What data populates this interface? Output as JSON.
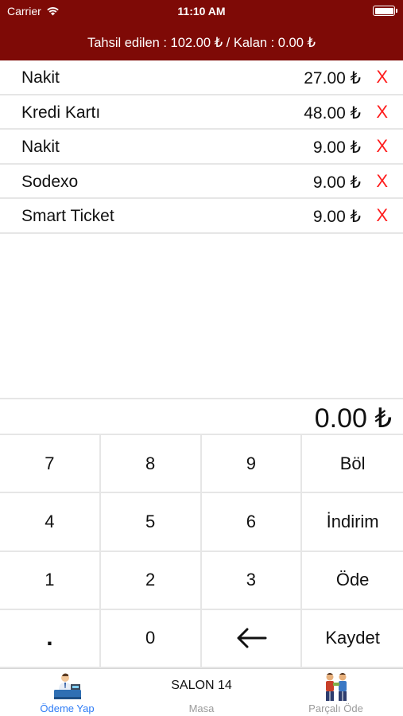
{
  "status_bar": {
    "carrier": "Carrier",
    "time": "11:10 AM"
  },
  "header": {
    "summary": "Tahsil edilen : 102.00 ₺ / Kalan : 0.00 ₺",
    "background": "#7e0a06"
  },
  "payments": [
    {
      "method": "Nakit",
      "amount": "27.00 ₺",
      "delete": "X"
    },
    {
      "method": "Kredi Kartı",
      "amount": "48.00 ₺",
      "delete": "X"
    },
    {
      "method": "Nakit",
      "amount": "9.00 ₺",
      "delete": "X"
    },
    {
      "method": "Sodexo",
      "amount": "9.00 ₺",
      "delete": "X"
    },
    {
      "method": "Smart Ticket",
      "amount": "9.00 ₺",
      "delete": "X"
    }
  ],
  "amount_display": "0.00 ₺",
  "keypad": {
    "k7": "7",
    "k8": "8",
    "k9": "9",
    "bol": "Böl",
    "k4": "4",
    "k5": "5",
    "k6": "6",
    "indirim": "İndirim",
    "k1": "1",
    "k2": "2",
    "k3": "3",
    "ode": "Öde",
    "dot": ".",
    "k0": "0",
    "backspace": "←",
    "kaydet": "Kaydet"
  },
  "tabbar": {
    "left_label": "Ödeme Yap",
    "center_title": "SALON 14",
    "center_label": "Masa",
    "right_label": "Parçalı Öde",
    "active_color": "#2e7cf6",
    "left_icon": "cashier-icon",
    "right_icon": "people-split-icon"
  },
  "colors": {
    "delete": "#ff1d1d"
  }
}
